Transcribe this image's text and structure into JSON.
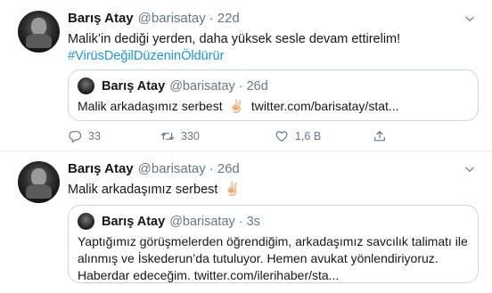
{
  "tweets": [
    {
      "name": "Barış Atay",
      "handle": "@barisatay",
      "dot": "·",
      "time": "22d",
      "text": "Malik’in dediği yerden, daha yüksek sesle devam ettirelim!",
      "hashtag": "#VirüsDeğilDüzeninÖldürür",
      "quote": {
        "name": "Barış Atay",
        "handle": "@barisatay",
        "dot": "·",
        "time": "26d",
        "text": "Malik arkadaşımız serbest",
        "emoji": "✌🏻",
        "link": "twitter.com/barisatay/stat..."
      },
      "actions": {
        "replies": "33",
        "retweets": "330",
        "likes": "1,6 B"
      }
    },
    {
      "name": "Barış Atay",
      "handle": "@barisatay",
      "dot": "·",
      "time": "26d",
      "text": "Malik arkadaşımız serbest",
      "emoji": "✌🏻",
      "quote": {
        "name": "Barış Atay",
        "handle": "@barisatay",
        "dot": "·",
        "time": "3s",
        "text": "Yaptığımız görüşmelerden öğrendiğim, arkadaşımız savcılık talimatı ile alınmış ve İskederun’da tutuluyor. Hemen avukat yönlendiriyoruz. Haberdar edeceğim. twitter.com/ilerihaber/sta..."
      }
    }
  ],
  "colors": {
    "text": "#14171a",
    "secondary": "#657786",
    "link": "#1b95e0",
    "border": "#ccd6dd",
    "divider": "#e6ecf0"
  },
  "icons": [
    "chevron-down-icon",
    "reply-icon",
    "retweet-icon",
    "like-icon",
    "share-icon",
    "victory-hand-emoji"
  ]
}
